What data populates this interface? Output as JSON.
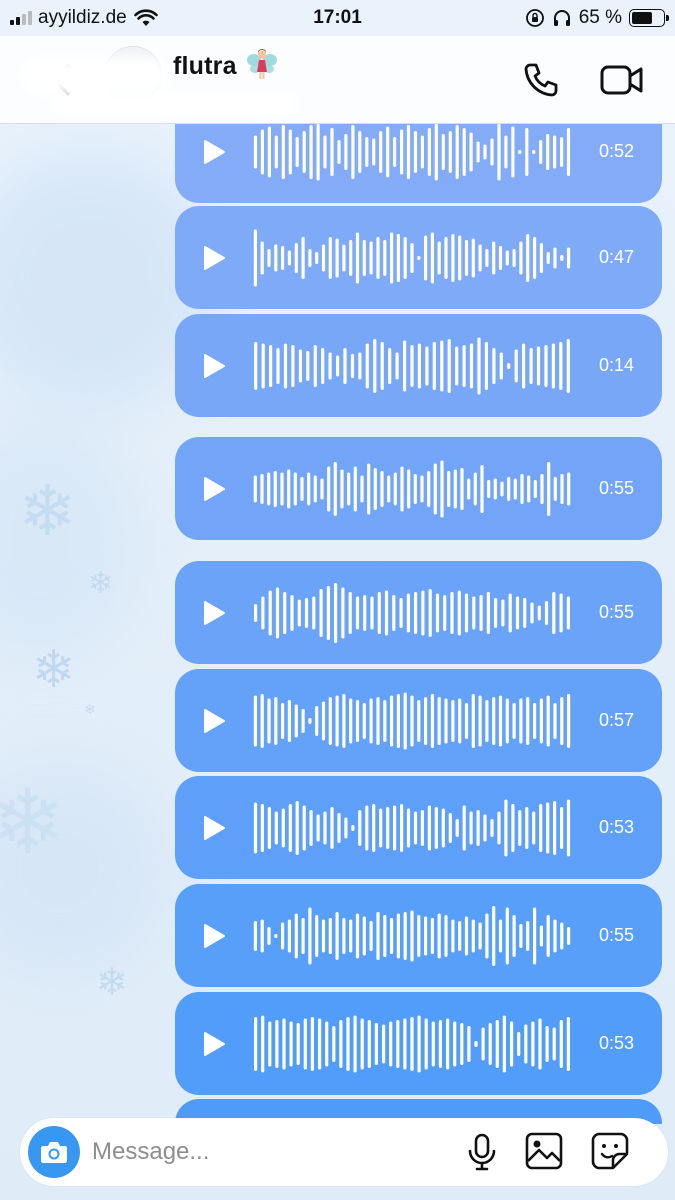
{
  "status_bar": {
    "carrier": "ayyildiz.de",
    "time": "17:01",
    "battery_percent": "65 %",
    "battery_level": 0.65
  },
  "header": {
    "contact_name": "flutra",
    "contact_emoji": "fairy-icon"
  },
  "messages": [
    {
      "duration": "0:52",
      "color": "#83abf7",
      "bars": [
        0.55,
        0.75,
        0.85,
        0.55,
        0.9,
        0.75,
        0.5,
        0.7,
        0.9,
        0.95,
        0.55,
        0.8,
        0.4,
        0.6,
        0.9,
        0.7,
        0.5,
        0.45,
        0.7,
        0.85,
        0.5,
        0.75,
        0.9,
        0.7,
        0.55,
        0.8,
        0.95,
        0.6,
        0.7,
        0.9,
        0.8,
        0.65,
        0.35,
        0.25,
        0.45,
        0.95,
        0.55,
        0.85,
        0.05,
        0.8,
        0.05,
        0.4,
        0.6,
        0.55,
        0.5,
        0.8
      ]
    },
    {
      "duration": "0:47",
      "color": "#7eaaf7",
      "bars": [
        0.95,
        0.55,
        0.3,
        0.45,
        0.4,
        0.25,
        0.5,
        0.7,
        0.3,
        0.2,
        0.45,
        0.7,
        0.65,
        0.45,
        0.6,
        0.85,
        0.6,
        0.55,
        0.7,
        0.6,
        0.85,
        0.8,
        0.7,
        0.5,
        0.05,
        0.75,
        0.85,
        0.55,
        0.7,
        0.8,
        0.75,
        0.6,
        0.65,
        0.45,
        0.3,
        0.55,
        0.4,
        0.25,
        0.3,
        0.55,
        0.8,
        0.7,
        0.5,
        0.2,
        0.35,
        0.1,
        0.35
      ]
    },
    {
      "duration": "0:14",
      "color": "#78a7f7",
      "bars": [
        0.8,
        0.75,
        0.7,
        0.6,
        0.75,
        0.7,
        0.55,
        0.5,
        0.7,
        0.6,
        0.45,
        0.35,
        0.6,
        0.4,
        0.45,
        0.75,
        0.9,
        0.8,
        0.6,
        0.45,
        0.85,
        0.7,
        0.75,
        0.65,
        0.8,
        0.85,
        0.9,
        0.65,
        0.7,
        0.75,
        0.95,
        0.8,
        0.6,
        0.45,
        0.1,
        0.55,
        0.75,
        0.6,
        0.65,
        0.7,
        0.75,
        0.8,
        0.9
      ]
    },
    {
      "duration": "0:55",
      "color": "#72a5f7",
      "bars": [
        0.45,
        0.5,
        0.55,
        0.6,
        0.55,
        0.65,
        0.55,
        0.4,
        0.55,
        0.45,
        0.35,
        0.75,
        0.9,
        0.65,
        0.55,
        0.75,
        0.45,
        0.85,
        0.7,
        0.6,
        0.45,
        0.55,
        0.75,
        0.65,
        0.5,
        0.45,
        0.6,
        0.85,
        0.95,
        0.6,
        0.65,
        0.7,
        0.35,
        0.55,
        0.8,
        0.3,
        0.35,
        0.25,
        0.4,
        0.35,
        0.5,
        0.45,
        0.3,
        0.5,
        0.9,
        0.4,
        0.5,
        0.55
      ]
    },
    {
      "duration": "0:55",
      "color": "#6aa3f8",
      "bars": [
        0.3,
        0.55,
        0.75,
        0.85,
        0.7,
        0.6,
        0.45,
        0.5,
        0.55,
        0.8,
        0.9,
        1.0,
        0.85,
        0.7,
        0.55,
        0.6,
        0.55,
        0.7,
        0.75,
        0.6,
        0.5,
        0.65,
        0.7,
        0.75,
        0.8,
        0.65,
        0.6,
        0.7,
        0.75,
        0.65,
        0.55,
        0.6,
        0.7,
        0.5,
        0.45,
        0.65,
        0.55,
        0.5,
        0.35,
        0.25,
        0.4,
        0.7,
        0.65,
        0.55
      ]
    },
    {
      "duration": "0:57",
      "color": "#64a1f8",
      "bars": [
        0.85,
        0.9,
        0.75,
        0.8,
        0.6,
        0.7,
        0.55,
        0.4,
        0.1,
        0.5,
        0.65,
        0.8,
        0.85,
        0.9,
        0.75,
        0.7,
        0.6,
        0.75,
        0.8,
        0.7,
        0.85,
        0.9,
        0.95,
        0.85,
        0.7,
        0.8,
        0.9,
        0.8,
        0.75,
        0.7,
        0.75,
        0.6,
        0.9,
        0.85,
        0.7,
        0.8,
        0.85,
        0.75,
        0.6,
        0.75,
        0.8,
        0.6,
        0.75,
        0.85,
        0.6,
        0.8,
        0.9
      ]
    },
    {
      "duration": "0:53",
      "color": "#5ea0f9",
      "bars": [
        0.85,
        0.8,
        0.7,
        0.55,
        0.65,
        0.8,
        0.9,
        0.75,
        0.6,
        0.45,
        0.55,
        0.7,
        0.5,
        0.35,
        0.1,
        0.6,
        0.75,
        0.8,
        0.65,
        0.7,
        0.75,
        0.8,
        0.65,
        0.55,
        0.6,
        0.75,
        0.7,
        0.65,
        0.5,
        0.3,
        0.75,
        0.55,
        0.6,
        0.45,
        0.3,
        0.55,
        0.95,
        0.8,
        0.6,
        0.7,
        0.55,
        0.8,
        0.85,
        0.9,
        0.7,
        0.95
      ]
    },
    {
      "duration": "0:55",
      "color": "#589ffa",
      "bars": [
        0.5,
        0.55,
        0.3,
        0.05,
        0.45,
        0.55,
        0.75,
        0.6,
        0.95,
        0.7,
        0.55,
        0.6,
        0.8,
        0.6,
        0.55,
        0.75,
        0.65,
        0.5,
        0.8,
        0.7,
        0.6,
        0.75,
        0.8,
        0.85,
        0.7,
        0.65,
        0.6,
        0.75,
        0.7,
        0.55,
        0.5,
        0.65,
        0.55,
        0.45,
        0.75,
        1.0,
        0.55,
        0.95,
        0.7,
        0.4,
        0.5,
        0.95,
        0.35,
        0.7,
        0.55,
        0.45,
        0.3
      ]
    },
    {
      "duration": "0:53",
      "color": "#539dfa",
      "bars": [
        0.9,
        0.95,
        0.75,
        0.8,
        0.85,
        0.75,
        0.7,
        0.85,
        0.9,
        0.85,
        0.75,
        0.6,
        0.8,
        0.9,
        0.95,
        0.85,
        0.8,
        0.7,
        0.65,
        0.75,
        0.8,
        0.85,
        0.9,
        0.95,
        0.85,
        0.75,
        0.8,
        0.85,
        0.75,
        0.7,
        0.6,
        0.1,
        0.55,
        0.7,
        0.8,
        0.95,
        0.75,
        0.4,
        0.65,
        0.75,
        0.85,
        0.6,
        0.55,
        0.8,
        0.9
      ]
    },
    {
      "duration": "",
      "color": "#4f9bfa",
      "bars": []
    }
  ],
  "composer": {
    "placeholder": "Message..."
  },
  "colors": {
    "bubble_text": "#ffffff",
    "camera_button": "#3897f0"
  }
}
